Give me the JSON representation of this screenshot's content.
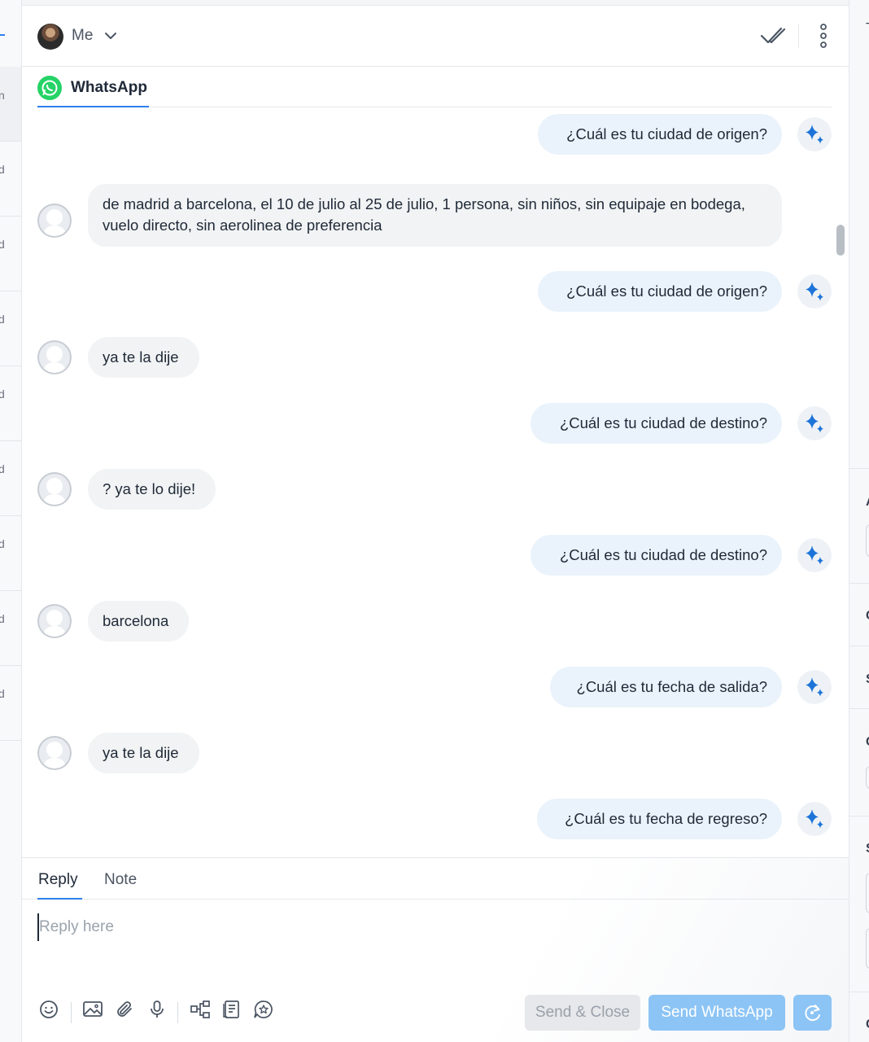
{
  "left_list": {
    "letters": [
      "n",
      "d",
      "d",
      "d",
      "d",
      "d",
      "d",
      "d",
      "d"
    ]
  },
  "header": {
    "assignee": "Me"
  },
  "channel_tab": {
    "label": "WhatsApp",
    "color": "#25d366"
  },
  "messages": [
    {
      "dir": "out",
      "text": "¿Cuál es tu ciudad de origen?"
    },
    {
      "dir": "in",
      "text": "de madrid a barcelona, el 10 de julio al 25 de julio, 1 persona, sin niños, sin equipaje en bodega, vuelo directo, sin aerolinea de preferencia"
    },
    {
      "dir": "out",
      "text": "¿Cuál es tu ciudad de origen?"
    },
    {
      "dir": "in",
      "text": "ya te la dije"
    },
    {
      "dir": "out",
      "text": "¿Cuál es tu ciudad de destino?"
    },
    {
      "dir": "in",
      "text": "? ya te lo dije!"
    },
    {
      "dir": "out",
      "text": "¿Cuál es tu ciudad de destino?"
    },
    {
      "dir": "in",
      "text": "barcelona"
    },
    {
      "dir": "out",
      "text": "¿Cuál es tu fecha de salida?"
    },
    {
      "dir": "in",
      "text": "ya te la dije"
    },
    {
      "dir": "out",
      "text": "¿Cuál es tu fecha de regreso?"
    }
  ],
  "composer": {
    "tab_reply": "Reply",
    "tab_note": "Note",
    "placeholder": "Reply here",
    "send_close_label": "Send & Close",
    "send_label": "Send WhatsApp"
  },
  "right_panel": {
    "letters": [
      "T",
      "A",
      "C",
      "S",
      "C",
      "S",
      "C"
    ]
  },
  "colors": {
    "accent": "#2f80ed",
    "send_button": "#8cc4f5",
    "outgoing_bubble": "#eaf3fb",
    "incoming_bubble": "#f1f3f4"
  }
}
